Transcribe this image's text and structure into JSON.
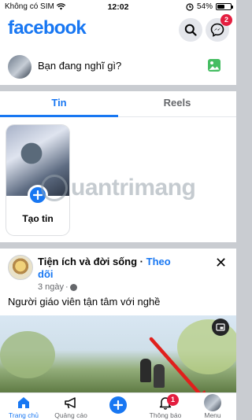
{
  "status_bar": {
    "carrier": "Không có SIM",
    "time": "12:02",
    "battery": "54%",
    "battery_level": 0.54
  },
  "header": {
    "logo": "facebook",
    "messenger_badge": "2"
  },
  "composer": {
    "prompt": "Bạn đang nghĩ gì?"
  },
  "stories": {
    "tabs": [
      {
        "label": "Tin",
        "active": true
      },
      {
        "label": "Reels",
        "active": false
      }
    ],
    "create_label": "Tạo tin"
  },
  "watermark": "uantrimang",
  "post": {
    "page_name": "Tiện ích và đời sống",
    "follow_label": "Theo",
    "follow_label_2": "dõi",
    "separator": "·",
    "time": "3 ngày",
    "text": "Người giáo viên tận tâm với nghề"
  },
  "bottom_nav": {
    "items": [
      {
        "label": "Trang chủ",
        "icon": "home-icon",
        "active": true
      },
      {
        "label": "Quảng cáo",
        "icon": "megaphone-icon"
      },
      {
        "label": "",
        "icon": "plus-icon"
      },
      {
        "label": "Thông báo",
        "icon": "bell-icon",
        "badge": "1"
      },
      {
        "label": "Menu",
        "icon": "avatar"
      }
    ]
  },
  "colors": {
    "brand": "#1877f2",
    "badge": "#e41e3f",
    "annotation_arrow": "#e0201c"
  }
}
